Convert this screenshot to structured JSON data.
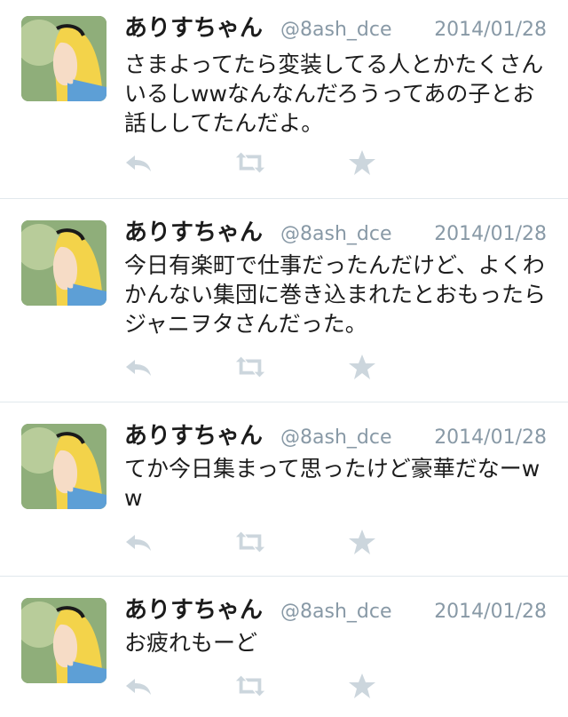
{
  "tweets": [
    {
      "name": "ありすちゃん",
      "handle": "@8ash_dce",
      "date": "2014/01/28",
      "text": "さまよってたら変装してる人とかたくさんいるしwwなんなんだろうってあの子とお話ししてたんだよ。"
    },
    {
      "name": "ありすちゃん",
      "handle": "@8ash_dce",
      "date": "2014/01/28",
      "text": "今日有楽町で仕事だったんだけど、よくわかんない集団に巻き込まれたとおもったらジャニヲタさんだった。"
    },
    {
      "name": "ありすちゃん",
      "handle": "@8ash_dce",
      "date": "2014/01/28",
      "text": "てか今日集まって思ったけど豪華だなーww"
    },
    {
      "name": "ありすちゃん",
      "handle": "@8ash_dce",
      "date": "2014/01/28",
      "text": "お疲れもーど"
    }
  ],
  "icons": {
    "avatar": "alice-avatar",
    "reply": "reply-icon",
    "retweet": "retweet-icon",
    "favorite": "star-icon"
  },
  "colors": {
    "icon_gray": "#ccd6dd",
    "meta_gray": "#8899a6",
    "divider": "#e1e8ed"
  }
}
